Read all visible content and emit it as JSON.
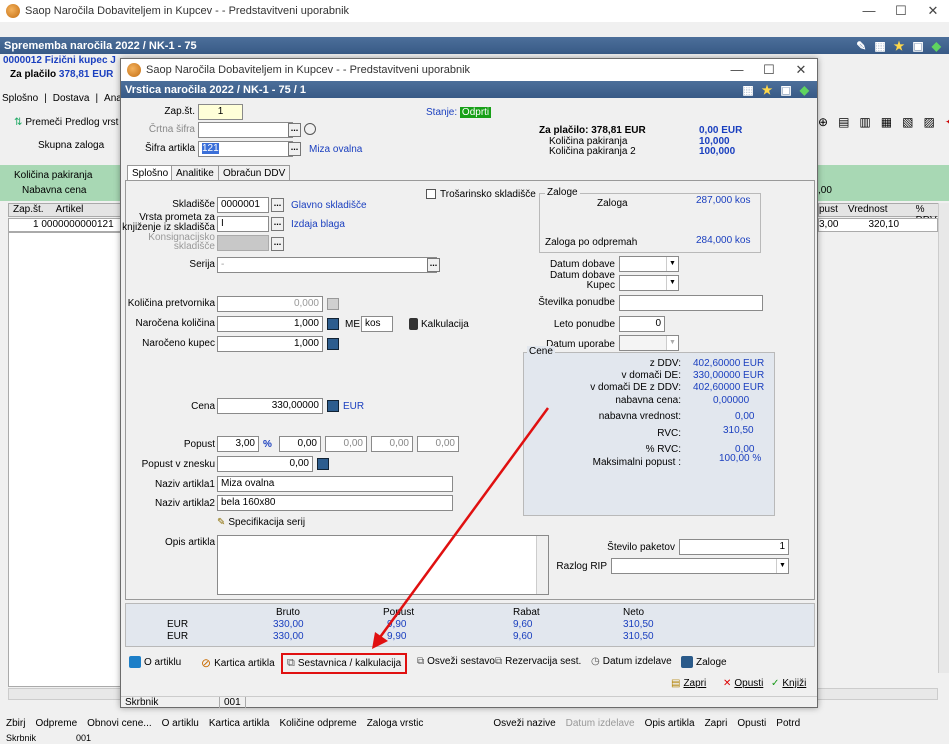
{
  "main_window": {
    "title": "Saop  Naročila Dobaviteljem in Kupcev - - Predstavitveni uporabnik",
    "header": "Sprememba naročila 2022 / NK-1 - 75",
    "customer": "0000012 Fizični kupec J",
    "payable_label": "Za plačilo",
    "payable_value": "378,81 EUR",
    "tabs": [
      "Splošno",
      "Dostava",
      "Anali"
    ],
    "toolbar": [
      "Premeči",
      "Predlog vrst"
    ],
    "stock_label": "Skupna zaloga",
    "green_labels": [
      "Količina pakiranja",
      "Nabavna cena"
    ],
    "grid_headers": [
      "Zap.št.",
      "Artikel"
    ],
    "grid_row": {
      "zap": "1",
      "artikel": "0000000000121"
    },
    "right_grid_headers": [
      "pust",
      "Vrednost",
      "% DDV"
    ],
    "right_green": ",00",
    "right_row": {
      "pust": "3,00",
      "vrednost": "320,10"
    },
    "bottom_toolbar": [
      "Zbirj",
      "Odpreme",
      "Obnovi cene...",
      "O artiklu",
      "Kartica artikla",
      "Količine odpreme",
      "Zaloga vrstic",
      "Osveži nazive",
      "Datum izdelave",
      "Opis artikla",
      "Zapri",
      "Opusti",
      "Potrd"
    ],
    "status_label": "Skrbnik",
    "status_value": "001"
  },
  "dialog": {
    "title": "Saop  Naročila Dobaviteljem in Kupcev - - Predstavitveni uporabnik",
    "header": "Vrstica naročila 2022 / NK-1 - 75 / 1",
    "zap_label": "Zap.št.",
    "zap_value": "1",
    "stanje_label": "Stanje:",
    "stanje_value": "Odprti",
    "crtna_label": "Črtna šifra",
    "sifra_label": "Šifra artikla",
    "sifra_value": "121",
    "article_name": "Miza ovalna",
    "summary": {
      "payable_label": "Za plačilo: 378,81 EUR",
      "payable_value": "0,00 EUR",
      "pack_label": "Količina pakiranja",
      "pack_value": "10,000",
      "pack2_label": "Količina pakiranja 2",
      "pack2_value": "100,000"
    },
    "tabs": [
      "Splošno",
      "Analitike",
      "Obračun DDV"
    ],
    "skladisce_label": "Skladišče",
    "skladisce_value": "0000001",
    "skladisce_name": "Glavno skladišče",
    "promet_label1": "Vrsta prometa za",
    "promet_label2": "knjiženje iz skladišča",
    "promet_value": "I",
    "promet_name": "Izdaja blaga",
    "konsig_label1": "Konsignacijsko",
    "konsig_label2": "skladišče",
    "serija_label": "Serija",
    "serija_value": "-",
    "trosarinsko_label": "Trošarinsko skladišče",
    "zaloge": {
      "title": "Zaloge",
      "zaloga_label": "Zaloga",
      "zaloga_value": "287,000 kos",
      "odpreme_label": "Zaloga po odpremah",
      "odpreme_value": "284,000 kos"
    },
    "kol_pretv_label": "Količina pretvornika",
    "kol_pretv_value": "0,000",
    "narocena_label": "Naročena količina",
    "narocena_value": "1,000",
    "me_label": "ME",
    "me_value": "kos",
    "kalkulacija_label": "Kalkulacija",
    "narocena_kupec_label": "Naročeno kupec",
    "narocena_kupec_value": "1,000",
    "datum_dobave_label": "Datum dobave",
    "datum_dobave_kupec_label1": "Datum dobave",
    "datum_dobave_kupec_label2": "Kupec",
    "st_ponudbe_label": "Številka ponudbe",
    "leto_ponudbe_label": "Leto ponudbe",
    "leto_ponudbe_value": "0",
    "datum_uporabe_label": "Datum uporabe",
    "cene": {
      "title": "Cene",
      "rows": [
        {
          "label": "z DDV:",
          "value": "402,60000 EUR"
        },
        {
          "label": "v domači DE:",
          "value": "330,00000 EUR"
        },
        {
          "label": "v domači DE z DDV:",
          "value": "402,60000 EUR"
        },
        {
          "label": "nabavna cena:",
          "value": "0,00000"
        },
        {
          "label": "nabavna vrednost:",
          "value": "0,00"
        },
        {
          "label": "RVC:",
          "value": "310,50"
        },
        {
          "label": "% RVC:",
          "value": "0,00"
        },
        {
          "label": "Maksimalni popust :",
          "value": "100,00 %"
        }
      ]
    },
    "cena_label": "Cena",
    "cena_value": "330,00000",
    "cena_currency": "EUR",
    "popust_label": "Popust",
    "popust_value": "3,00",
    "popust_pct": "%",
    "popust_extra": [
      "0,00",
      "0,00",
      "0,00",
      "0,00"
    ],
    "popust_zn_label": "Popust v znesku",
    "popust_zn_value": "0,00",
    "naziv1_label": "Naziv artikla1",
    "naziv1_value": "Miza ovalna",
    "naziv2_label": "Naziv artikla2",
    "naziv2_value": "bela 160x80",
    "spec_label": "Specifikacija serij",
    "opis_label": "Opis artikla",
    "st_paketov_label": "Število paketov",
    "st_paketov_value": "1",
    "razlog_label": "Razlog RIP",
    "totals": {
      "headers": [
        "Bruto",
        "Popust",
        "Rabat",
        "Neto"
      ],
      "rows": [
        {
          "cur": "EUR",
          "bruto": "330,00",
          "popust": "9,90",
          "rabat": "9,60",
          "neto": "310,50"
        },
        {
          "cur": "EUR",
          "bruto": "330,00",
          "popust": "9,90",
          "rabat": "9,60",
          "neto": "310,50"
        }
      ]
    },
    "buttons": [
      "O artiklu",
      "Kartica artikla",
      "Sestavnica / kalkulacija",
      "Osveži sestavo",
      "Rezervacija sest.",
      "Datum izdelave",
      "Zaloge"
    ],
    "footer_buttons": [
      "Zapri",
      "Opusti",
      "Knjiži"
    ],
    "status_label": "Skrbnik",
    "status_value": "001",
    "accent": "#e01010"
  }
}
